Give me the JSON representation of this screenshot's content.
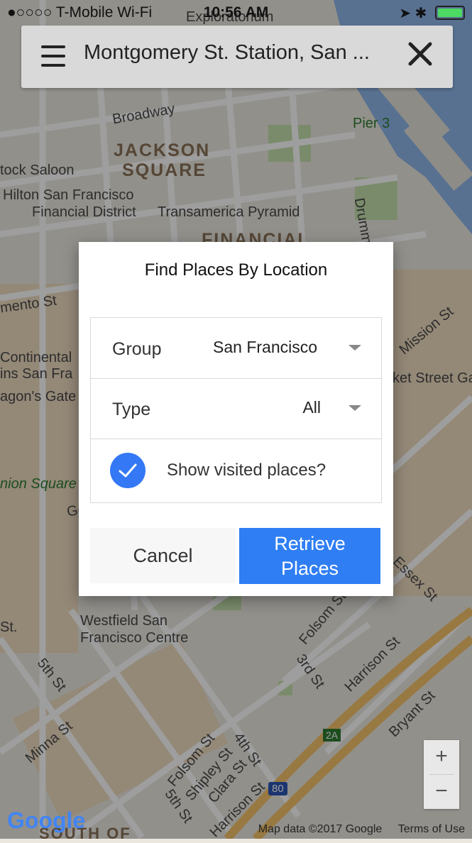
{
  "status": {
    "carrier": "●○○○○ T-Mobile Wi-Fi",
    "time": "10:56 AM",
    "right": "➤ ✱"
  },
  "search": {
    "query": "Montgomery St. Station, San ..."
  },
  "map_labels": {
    "exploratorium": "Exploratorium",
    "broadway": "Broadway",
    "jackson": "JACKSON",
    "square": "SQUARE",
    "pier3": "Pier 3",
    "saloon": "tock Saloon",
    "hilton": "Hilton San Francisco",
    "fin_dist": "Financial District",
    "transamerica": "Transamerica Pyramid",
    "financial": "FINANCIAL",
    "drumm": "Drumm",
    "mento": "mento St",
    "continental": "Continental",
    "ins_san_fra": "ins San Fra",
    "agons_gate": "agon's Gate",
    "mission": "Mission St",
    "ket_street": "ket Street Ga",
    "union_square": "nion Square",
    "geary": "Geary St",
    "westfield1": "Westfield San",
    "westfield2": "Francisco Centre",
    "fifth": "5th St",
    "minna": "Minna St",
    "folsom": "Folsom St",
    "third": "3rd St",
    "harrison": "Harrison St",
    "bryant": "Bryant St",
    "essex": "Essex St",
    "shipley": "Shipley St",
    "clara": "Clara St",
    "fourth": "4th St",
    "fifth2": "5th St",
    "harrison2": "Harrison St",
    "folsom2": "Folsom St",
    "st_left": "St.",
    "i80": "80",
    "exit2a": "2A",
    "south_of": "SOUTH OF"
  },
  "dialog": {
    "title": "Find Places By Location",
    "group_label": "Group",
    "group_value": "San Francisco",
    "type_label": "Type",
    "type_value": "All",
    "visited_label": "Show visited places?",
    "visited_checked": true,
    "cancel_label": "Cancel",
    "retrieve_label": "Retrieve Places"
  },
  "zoom": {
    "in": "+",
    "out": "−"
  },
  "footer": {
    "logo": "Google",
    "map_data": "Map data ©2017 Google",
    "terms": "Terms of Use"
  },
  "colors": {
    "accent": "#2f7ef3",
    "water": "#7ea9e6",
    "park": "#b9dca0",
    "road": "#ffffff"
  }
}
